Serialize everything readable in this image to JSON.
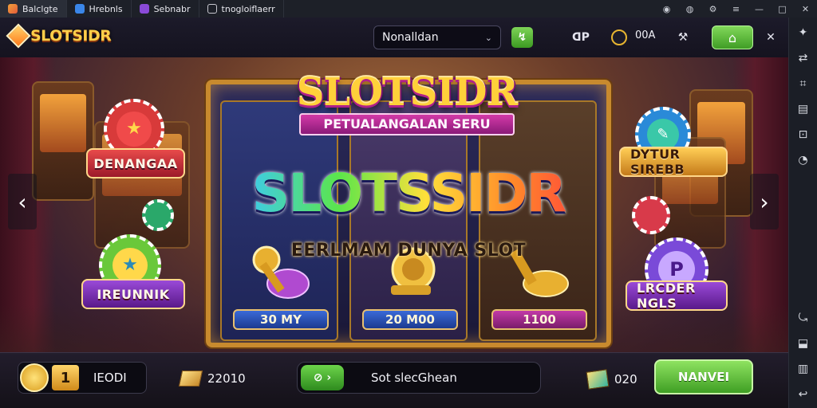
{
  "browser": {
    "tabs": [
      {
        "label": "Balclgte",
        "icon": "game-icon",
        "color": "#e25b3a"
      },
      {
        "label": "Hrebnls",
        "icon": "app-icon",
        "color": "#3a86e8"
      },
      {
        "label": "Sebnabr",
        "icon": "avatar-icon",
        "color": "#8a4ad8"
      },
      {
        "label": "tnogloiflaerr",
        "icon": "link-icon",
        "color": "#c8c8d0"
      }
    ],
    "controls": [
      "◉",
      "◍",
      "⚙",
      "≡",
      "—",
      "□",
      "✕"
    ]
  },
  "game": {
    "logo": "SLOTSIDR",
    "server_select": {
      "value": "Nonalldan",
      "options": [
        "Nonalldan"
      ]
    },
    "top_icons": {
      "go": "↯",
      "ranking": "ᗡP",
      "coins": "00A",
      "tools": "⚒",
      "home": "⌂",
      "close": "✕"
    },
    "banner_title": "SLOTSIDR",
    "banner_ribbon": "PETUALANGALAN SERU",
    "main_title": "SLOTSSIDR",
    "main_subtitle": "EERLMAM DUNYA SLOT",
    "reels": [
      {
        "value": "30 MY",
        "style": "blue"
      },
      {
        "value": "20 M00",
        "style": "blue"
      },
      {
        "value": "1100",
        "style": "purple"
      }
    ],
    "badges": {
      "left_top": "DENANGAA",
      "left_bottom": "IREUNNIK",
      "right_top": "DYTUR SIREBB",
      "right_bottom": "LRCDER NGLS"
    },
    "chips": {
      "star": "★",
      "p": "P",
      "pencil": "✎"
    },
    "nav": {
      "left": "‹",
      "right": "›"
    },
    "bottom": {
      "level_number": "1",
      "level_name": "IEODI",
      "gold_amount": "22010",
      "message_chip": "⊘ ›",
      "message_text": "Sot slecGhean",
      "gems_amount": "020",
      "action_label": "NANVEI"
    }
  },
  "sidebar": {
    "buttons": [
      "✦",
      "⇄",
      "⌗",
      "▤",
      "⊡",
      "◔",
      "⤿",
      "⬓",
      "▥",
      "↩"
    ]
  },
  "colors": {
    "accent_gold": "#ffcf4a",
    "accent_green": "#5cb83a",
    "accent_purple": "#a83ab8"
  }
}
